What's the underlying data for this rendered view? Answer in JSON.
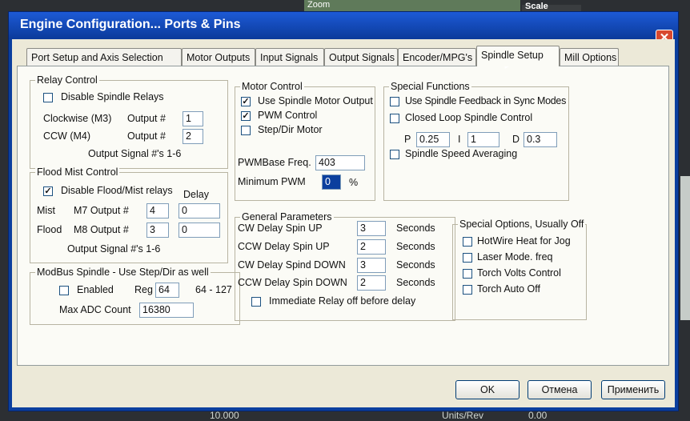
{
  "background": {
    "zoom_label": "Zoom",
    "scale_label": "Scale",
    "bottom_value_1": "10.000",
    "bottom_value_2": "0.00",
    "bottom_label": "Units/Rev"
  },
  "window": {
    "title": "Engine Configuration... Ports & Pins",
    "close_glyph": "✕"
  },
  "tabs": [
    {
      "label": "Port Setup and Axis Selection"
    },
    {
      "label": "Motor Outputs"
    },
    {
      "label": "Input Signals"
    },
    {
      "label": "Output Signals"
    },
    {
      "label": "Encoder/MPG's"
    },
    {
      "label": "Spindle Setup"
    },
    {
      "label": "Mill Options"
    }
  ],
  "relay_control": {
    "title": "Relay Control",
    "disable_label": "Disable Spindle Relays",
    "disable_checked": false,
    "cw_label": "Clockwise (M3)",
    "ccw_label": "CCW (M4)",
    "output_label": "Output #",
    "cw_output": "1",
    "ccw_output": "2",
    "signals_note": "Output Signal #'s 1-6"
  },
  "flood_mist": {
    "title": "Flood Mist Control",
    "disable_label": "Disable Flood/Mist relays",
    "disable_checked": true,
    "delay_label": "Delay",
    "mist_label": "Mist",
    "mist_output_label": "M7 Output #",
    "mist_output": "4",
    "mist_delay": "0",
    "flood_label": "Flood",
    "flood_output_label": "M8 Output #",
    "flood_output": "3",
    "flood_delay": "0",
    "signals_note": "Output Signal #'s 1-6"
  },
  "modbus": {
    "title": "ModBus Spindle - Use Step/Dir as well",
    "enabled_label": "Enabled",
    "enabled_checked": false,
    "reg_label": "Reg",
    "reg_value": "64",
    "reg_range": "64 - 127",
    "max_adc_label": "Max ADC Count",
    "max_adc_value": "16380"
  },
  "motor_control": {
    "title": "Motor Control",
    "use_spindle_label": "Use Spindle Motor Output",
    "use_spindle_checked": true,
    "pwm_label": "PWM Control",
    "pwm_checked": true,
    "stepdir_label": "Step/Dir Motor",
    "stepdir_checked": false,
    "pwm_base_label": "PWMBase Freq.",
    "pwm_base_value": "403",
    "min_pwm_label": "Minimum PWM",
    "min_pwm_value": "0",
    "percent": "%"
  },
  "special_functions": {
    "title": "Special Functions",
    "sync_label": "Use Spindle Feedback in Sync Modes",
    "sync_checked": false,
    "closed_loop_label": "Closed Loop Spindle Control",
    "closed_loop_checked": false,
    "p_label": "P",
    "p_value": "0.25",
    "i_label": "I",
    "i_value": "1",
    "d_label": "D",
    "d_value": "0.3",
    "averaging_label": "Spindle Speed Averaging",
    "averaging_checked": false
  },
  "general_params": {
    "title": "General Parameters",
    "seconds_label": "Seconds",
    "rows": [
      {
        "label": "CW Delay Spin UP",
        "value": "3"
      },
      {
        "label": "CCW Delay Spin UP",
        "value": "2"
      },
      {
        "label": "CW Delay Spind DOWN",
        "value": "3"
      },
      {
        "label": "CCW Delay Spin DOWN",
        "value": "2"
      }
    ],
    "immediate_label": "Immediate Relay off before delay",
    "immediate_checked": false
  },
  "special_options": {
    "title": "Special Options, Usually Off",
    "items": [
      {
        "label": "HotWire Heat for Jog",
        "checked": false
      },
      {
        "label": "Laser Mode. freq",
        "checked": false
      },
      {
        "label": "Torch Volts Control",
        "checked": false
      },
      {
        "label": "Torch Auto Off",
        "checked": false
      }
    ]
  },
  "buttons": {
    "ok": "OK",
    "cancel": "Отмена",
    "apply": "Применить"
  }
}
